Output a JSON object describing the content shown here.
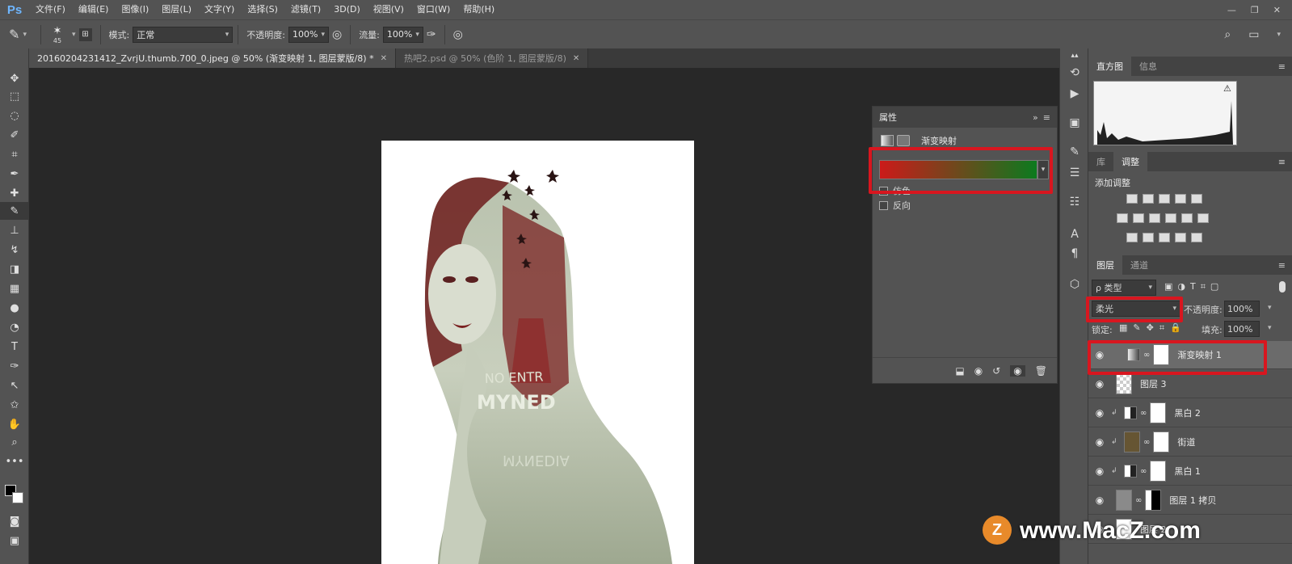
{
  "app": {
    "logo": "Ps"
  },
  "menu": [
    "文件(F)",
    "编辑(E)",
    "图像(I)",
    "图层(L)",
    "文字(Y)",
    "选择(S)",
    "滤镜(T)",
    "3D(D)",
    "视图(V)",
    "窗口(W)",
    "帮助(H)"
  ],
  "window_controls": {
    "minimize": "—",
    "restore": "❐",
    "close": "✕"
  },
  "options": {
    "brush_size": "45",
    "mode_label": "模式:",
    "mode_value": "正常",
    "opacity_label": "不透明度:",
    "opacity_value": "100%",
    "flow_label": "流量:",
    "flow_value": "100%"
  },
  "tabs": [
    {
      "label": "20160204231412_ZvrjU.thumb.700_0.jpeg @ 50% (渐变映射 1, 图层蒙版/8) *",
      "close": "✕"
    },
    {
      "label": "热吧2.psd @ 50% (色阶 1, 图层蒙版/8)",
      "close": "✕"
    }
  ],
  "canvas_text": {
    "line1": "NO ENTR",
    "line2": "MYNED",
    "mirror": "MYNEDIA"
  },
  "properties": {
    "tab": "属性",
    "adjustment": "渐变映射",
    "dither": "仿色",
    "reverse": "反向",
    "gradient_colors": [
      "#cc1a1a",
      "#0c7a1e"
    ]
  },
  "histogram": {
    "tabs": [
      "直方图",
      "信息"
    ],
    "warning": "⚠"
  },
  "adjustments": {
    "tabs": [
      "库",
      "调整"
    ],
    "add_label": "添加调整"
  },
  "layers_panel": {
    "tabs": [
      "图层",
      "通道"
    ],
    "filter_kind": "ρ 类型",
    "blend_mode": "柔光",
    "opacity_label": "不透明度:",
    "opacity_value": "100%",
    "lock_label": "锁定:",
    "fill_label": "填充:",
    "fill_value": "100%",
    "layers": [
      {
        "name": "渐变映射 1",
        "selected": true
      },
      {
        "name": "图层 3",
        "selected": false
      },
      {
        "name": "黑白 2",
        "selected": false
      },
      {
        "name": "街道",
        "selected": false
      },
      {
        "name": "黑白 1",
        "selected": false
      },
      {
        "name": "图层 1 拷贝",
        "selected": false
      },
      {
        "name": "图层 2",
        "selected": false
      }
    ]
  },
  "watermark": {
    "text": "www.MacZ.com",
    "logo_letter": "Z"
  },
  "colors": {
    "ui_dark": "#535353",
    "highlight": "#d8161f",
    "canvas_bg": "#282828"
  }
}
